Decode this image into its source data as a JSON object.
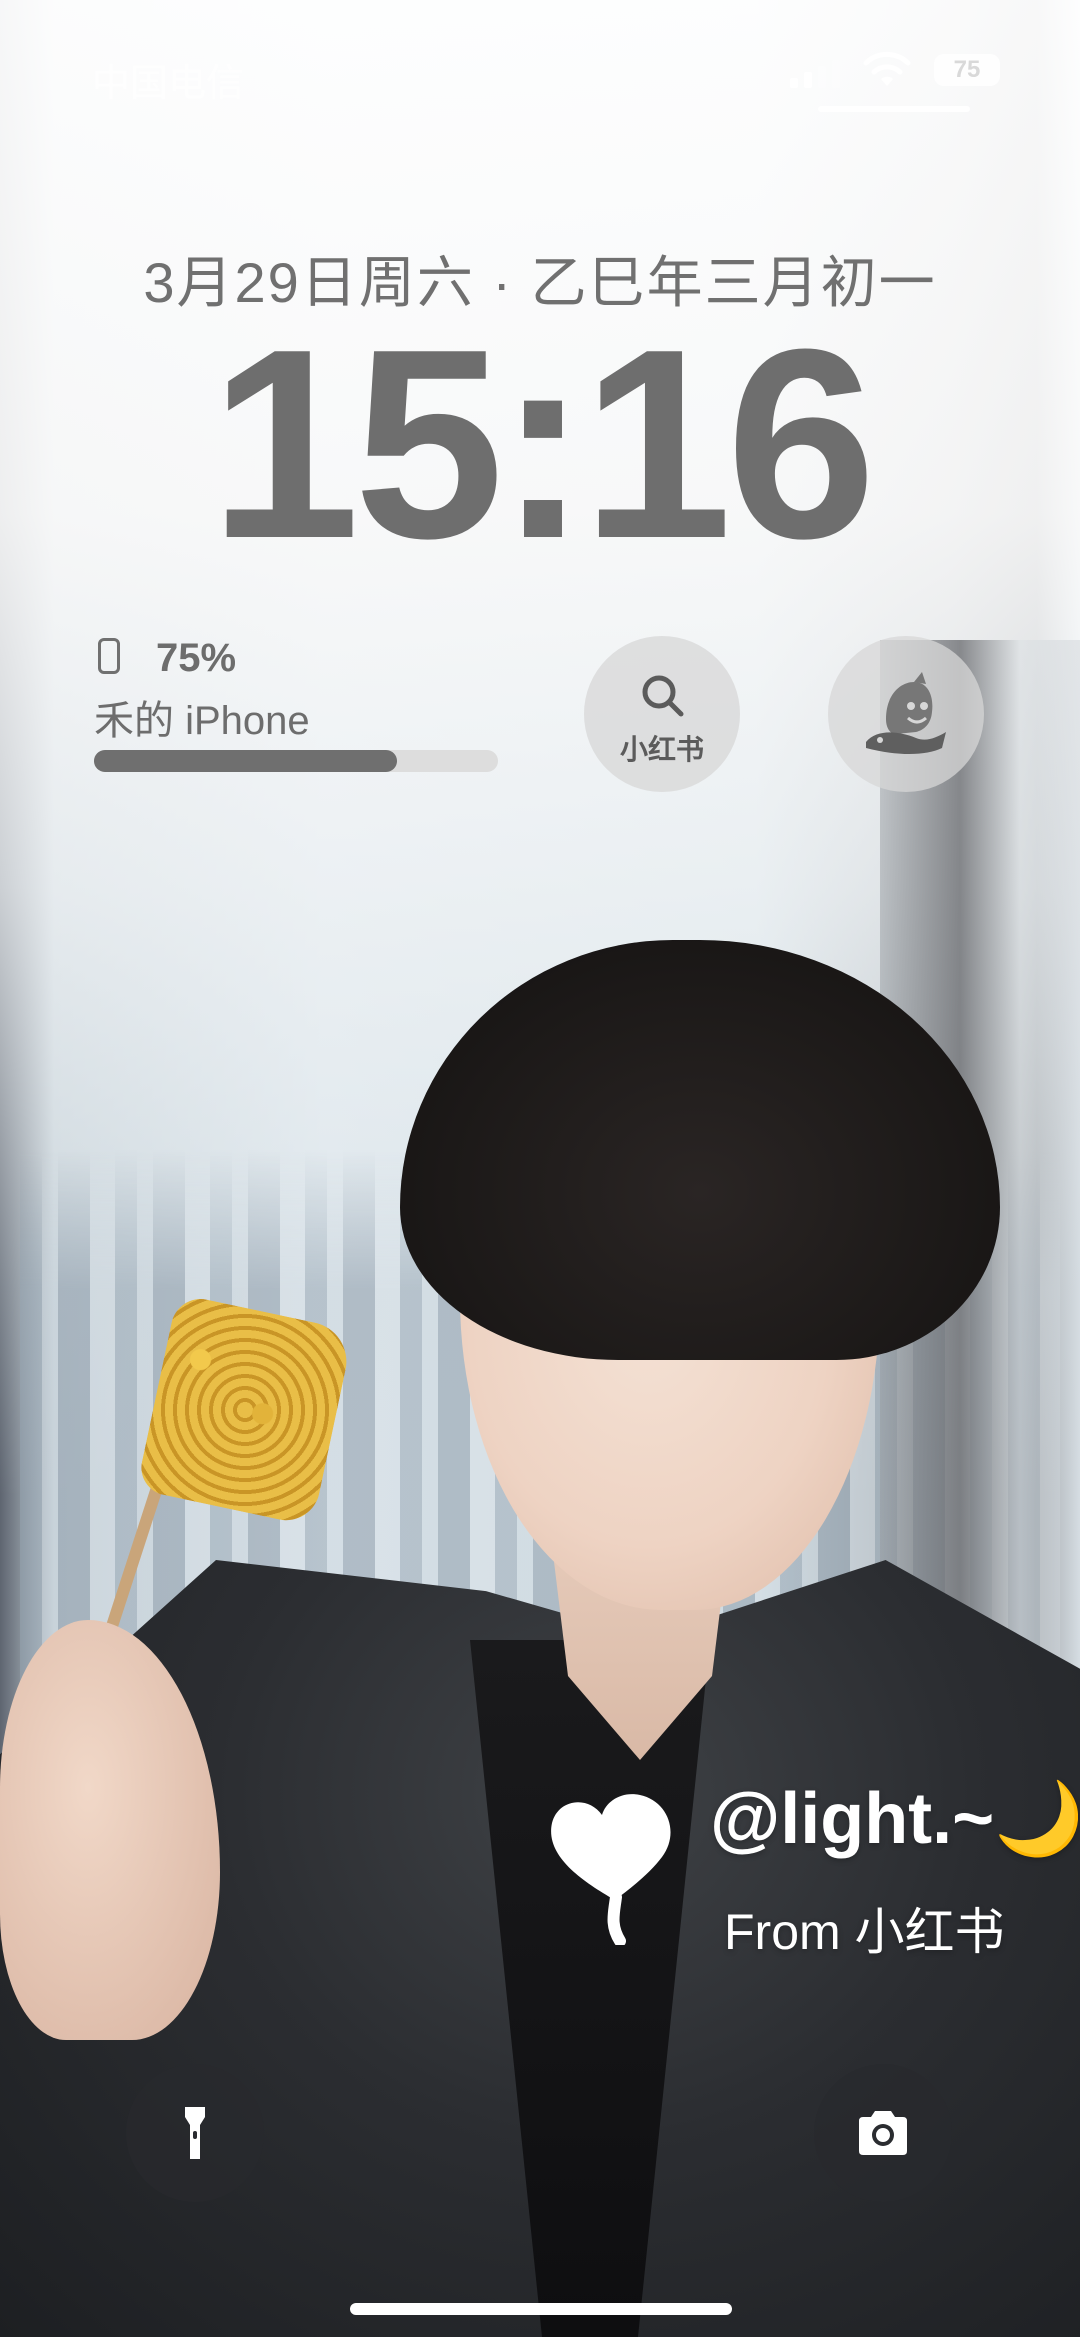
{
  "status_bar": {
    "carrier": "中国电信",
    "battery_level": "75"
  },
  "lock_screen": {
    "date": "3月29日周六 · 乙巳年三月初一",
    "time": "15:16"
  },
  "battery_widget": {
    "percent_text": "75%",
    "device_name": "禾的 iPhone",
    "fill_fraction": 0.75,
    "device_icon": "phone-icon"
  },
  "widgets": {
    "xiaohongshu_search": {
      "icon": "search-icon",
      "label": "小红书"
    },
    "sticker_app": {
      "icon": "fish-mascot-icon"
    }
  },
  "wallpaper_overlay": {
    "handle": "@light.~🌙",
    "source": "From 小红书"
  },
  "quick_actions": {
    "left": {
      "icon": "flashlight-icon"
    },
    "right": {
      "icon": "camera-icon"
    }
  },
  "colors": {
    "clock_gray": "#6e6e6e",
    "widget_bg": "#d7d7d7",
    "quick_btn_bg": "#2a2c30"
  }
}
